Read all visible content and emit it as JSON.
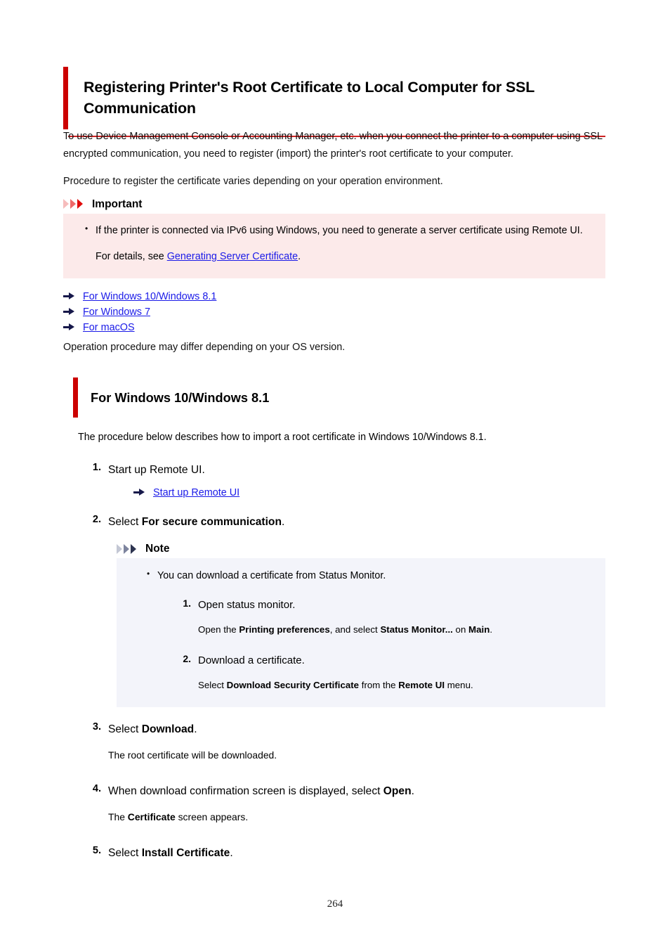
{
  "document": {
    "title": "Registering Printer's Root Certificate to Local Computer for SSL Communication",
    "page_number": "264",
    "accent_color": "#cc0000",
    "link_color": "#1a1ae8",
    "important_box_color": "#fceaea",
    "note_box_color": "#f3f4fa"
  },
  "intro": {
    "paragraph1": "To use Device Management Console or Accounting Manager, etc. when you connect the printer to a computer using SSL encrypted communication, you need to register (import) the printer's root certificate to your computer.",
    "paragraph2": "Procedure to register the certificate varies depending on your operation environment."
  },
  "important": {
    "icon": "chevrons-icon",
    "label": "Important",
    "bullet1_prefix": "If the printer is connected via IPv6 using Windows, you need to generate a server certificate using Remote UI.",
    "detail_prefix": "For details, see ",
    "detail_link": "Generating Server Certificate",
    "detail_suffix": "."
  },
  "toc_links": [
    {
      "label": "For Windows 10/Windows 8.1",
      "icon": "arrow-right-icon"
    },
    {
      "label": "For Windows 7",
      "icon": "arrow-right-icon"
    },
    {
      "label": "For macOS",
      "icon": "arrow-right-icon"
    }
  ],
  "os_note": "Operation procedure may differ depending on your OS version.",
  "section": {
    "heading": "For Windows 10/Windows 8.1",
    "intro": "The procedure below describes how to import a root certificate in Windows 10/Windows 8.1."
  },
  "steps": [
    {
      "num": "1.",
      "text": "Start up Remote UI.",
      "link": {
        "label": "Start up Remote UI",
        "icon": "arrow-right-icon"
      }
    },
    {
      "num": "2.",
      "text_prefix": "Select ",
      "text_bold": "For secure communication",
      "text_suffix": "."
    },
    {
      "num": "3.",
      "text_prefix": "Select ",
      "text_bold": "Download",
      "text_suffix": ".",
      "detail": "The root certificate will be downloaded."
    },
    {
      "num": "4.",
      "text_prefix": "When download confirmation screen is displayed, select ",
      "text_bold": "Open",
      "text_suffix": ".",
      "detail_prefix": "The ",
      "detail_bold": "Certificate",
      "detail_suffix": " screen appears."
    },
    {
      "num": "5.",
      "text_prefix": "Select ",
      "text_bold": "Install Certificate",
      "text_suffix": "."
    }
  ],
  "note": {
    "icon": "chevrons-icon",
    "label": "Note",
    "bullet": "You can download a certificate from Status Monitor.",
    "substeps": [
      {
        "num": "1.",
        "text": "Open status monitor.",
        "detail_a": "Open the ",
        "detail_b1": "Printing preferences",
        "detail_c": ", and select ",
        "detail_b2": "Status Monitor...",
        "detail_d": " on ",
        "detail_b3": "Main",
        "detail_e": "."
      },
      {
        "num": "2.",
        "text": "Download a certificate.",
        "detail_a": "Select ",
        "detail_b1": "Download Security Certificate",
        "detail_c": " from the ",
        "detail_b2": "Remote UI",
        "detail_d": " menu."
      }
    ]
  }
}
